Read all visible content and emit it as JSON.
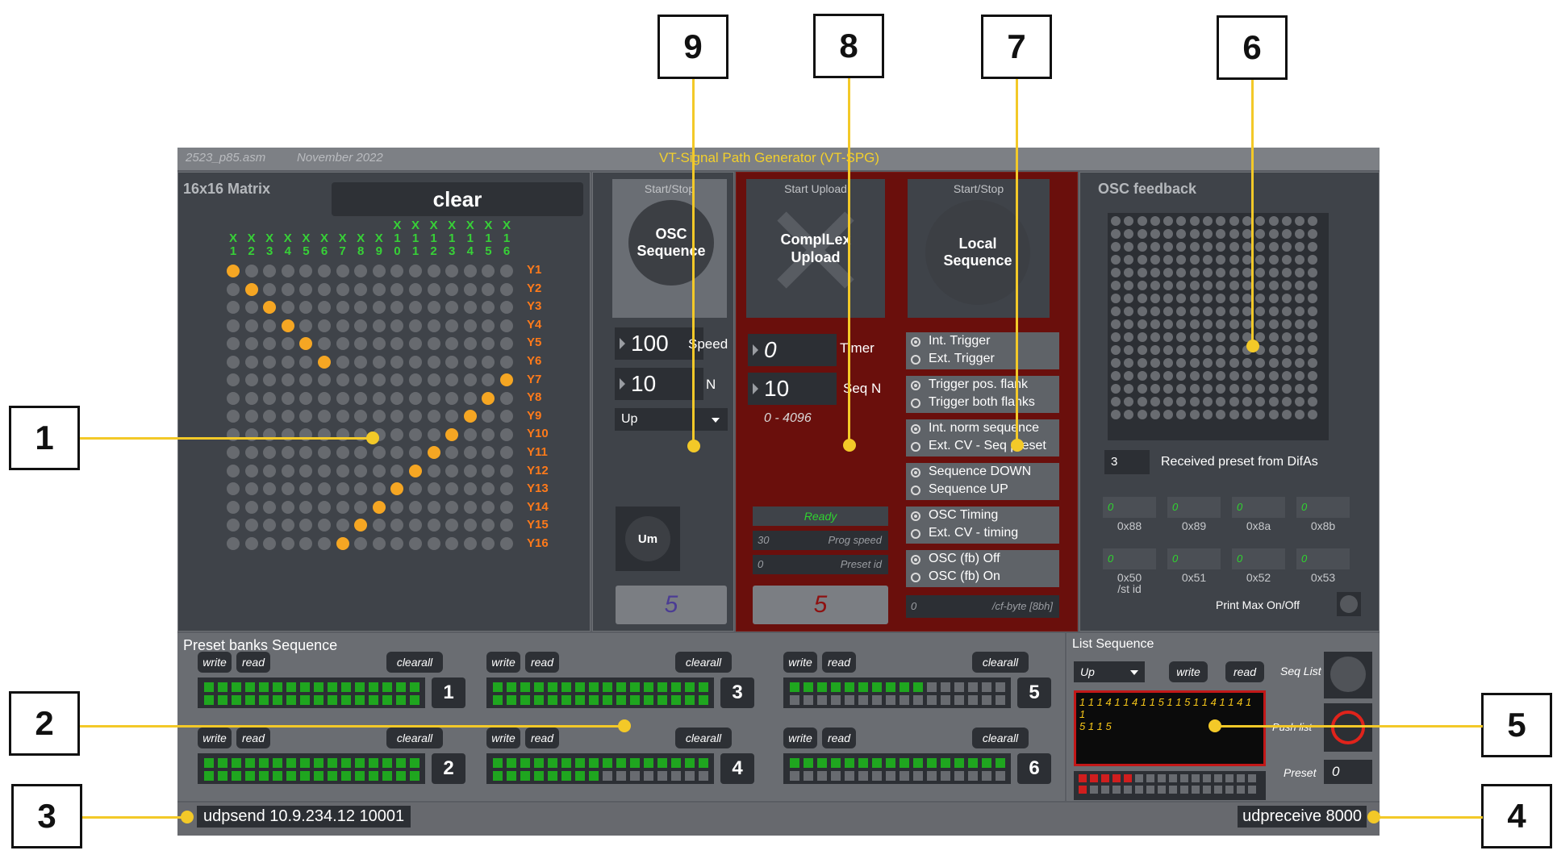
{
  "title_bar": {
    "file": "2523_p85.asm",
    "date": "November 2022",
    "app_title": "VT-Signal Path Generator (VT-SPG)"
  },
  "matrix": {
    "title": "16x16 Matrix",
    "clear_label": "clear",
    "columns": [
      [
        "X",
        "1"
      ],
      [
        "X",
        "2"
      ],
      [
        "X",
        "3"
      ],
      [
        "X",
        "4"
      ],
      [
        "X",
        "5"
      ],
      [
        "X",
        "6"
      ],
      [
        "X",
        "7"
      ],
      [
        "X",
        "8"
      ],
      [
        "X",
        "9"
      ],
      [
        "X",
        "1",
        "0"
      ],
      [
        "X",
        "1",
        "1"
      ],
      [
        "X",
        "1",
        "2"
      ],
      [
        "X",
        "1",
        "3"
      ],
      [
        "X",
        "1",
        "4"
      ],
      [
        "X",
        "1",
        "5"
      ],
      [
        "X",
        "1",
        "6"
      ]
    ],
    "rows": [
      "Y1",
      "Y2",
      "Y3",
      "Y4",
      "Y5",
      "Y6",
      "Y7",
      "Y8",
      "Y9",
      "Y10",
      "Y11",
      "Y12",
      "Y13",
      "Y14",
      "Y15",
      "Y16"
    ],
    "active_cells": [
      [
        1,
        1
      ],
      [
        2,
        2
      ],
      [
        3,
        3
      ],
      [
        4,
        4
      ],
      [
        5,
        5
      ],
      [
        6,
        6
      ],
      [
        7,
        16
      ],
      [
        8,
        15
      ],
      [
        9,
        14
      ],
      [
        10,
        13
      ],
      [
        11,
        12
      ],
      [
        12,
        11
      ],
      [
        13,
        10
      ],
      [
        14,
        9
      ],
      [
        15,
        8
      ],
      [
        16,
        7
      ]
    ],
    "colors": {
      "x_label": "#37d137",
      "y_label": "#ff7a1a",
      "dot_on": "#f5a623",
      "dot_off": "#676a6f"
    }
  },
  "osc_panel": {
    "start_stop": "Start/Stop",
    "button_line1": "OSC",
    "button_line2": "Sequence",
    "speed_value": "100",
    "speed_label": "Speed",
    "n_value": "10",
    "n_label": "N",
    "direction": "Up",
    "um_label": "Um",
    "counter": "5"
  },
  "complex_panel": {
    "start_upload": "Start Upload",
    "button_line1": "ComplLex",
    "button_line2": "Upload",
    "timer_value": "0",
    "timer_label": "Timer",
    "seqn_value": "10",
    "seqn_label": "Seq N",
    "range": "0 - 4096",
    "status": "Ready",
    "prog_speed_value": "30",
    "prog_speed_label": "Prog speed",
    "preset_id_value": "0",
    "preset_id_label": "Preset id",
    "counter": "5"
  },
  "local_panel": {
    "start_stop": "Start/Stop",
    "button_line1": "Local",
    "button_line2": "Sequence",
    "radio_groups": [
      {
        "options": [
          "Int. Trigger",
          "Ext. Trigger"
        ],
        "selected": 0
      },
      {
        "options": [
          "Trigger pos. flank",
          "Trigger both flanks"
        ],
        "selected": 0
      },
      {
        "options": [
          "Int. norm sequence",
          "Ext. CV - Seq preset"
        ],
        "selected": 0
      },
      {
        "options": [
          "Sequence DOWN",
          "Sequence UP"
        ],
        "selected": 0
      },
      {
        "options": [
          "OSC Timing",
          "Ext. CV - timing"
        ],
        "selected": 0
      },
      {
        "options": [
          "OSC (fb) Off",
          "OSC (fb) On"
        ],
        "selected": 0
      }
    ],
    "cf_byte_value": "0",
    "cf_byte_label": "/cf-byte [8bh]"
  },
  "osc_feedback": {
    "title": "OSC feedback",
    "preset_value": "3",
    "preset_label": "Received preset from DifAs",
    "hex_row1": [
      {
        "value": "0",
        "label": "0x88"
      },
      {
        "value": "0",
        "label": "0x89"
      },
      {
        "value": "0",
        "label": "0x8a"
      },
      {
        "value": "0",
        "label": "0x8b"
      }
    ],
    "hex_row2": [
      {
        "value": "0",
        "label": "0x50"
      },
      {
        "value": "0",
        "label": "0x51"
      },
      {
        "value": "0",
        "label": "0x52"
      },
      {
        "value": "0",
        "label": "0x53"
      }
    ],
    "st_id_label": "/st id",
    "print_label": "Print Max On/Off"
  },
  "preset_banks": {
    "title": "Preset banks Sequence",
    "write_label": "write",
    "read_label": "read",
    "clearall_label": "clearall",
    "banks": [
      {
        "num": "1",
        "top_green": 16,
        "bottom_green": 16
      },
      {
        "num": "2",
        "top_green": 16,
        "bottom_green": 16
      },
      {
        "num": "3",
        "top_green": 16,
        "bottom_green": 16
      },
      {
        "num": "4",
        "top_green": 16,
        "bottom_green": 8
      },
      {
        "num": "5",
        "top_green": 10,
        "bottom_green": 0
      },
      {
        "num": "6",
        "top_green": 16,
        "bottom_green": 0
      }
    ]
  },
  "list_sequence": {
    "title": "List Sequence",
    "direction": "Up",
    "write_label": "write",
    "read_label": "read",
    "seq_list_label": "Seq List",
    "push_list_label": "Push list",
    "preset_label": "Preset",
    "preset_value": "0",
    "list_line1": "1 1 1 4 1 1 4 1 1 5 1 1 5 1 1 4 1 1 4 1 1",
    "list_line2": "5 1 1 5",
    "red_leds": 5
  },
  "status_bar": {
    "udpsend": "udpsend 10.9.234.12 10001",
    "udpreceive": "udpreceive 8000"
  },
  "callouts": [
    "1",
    "2",
    "3",
    "4",
    "5",
    "6",
    "7",
    "8",
    "9"
  ]
}
